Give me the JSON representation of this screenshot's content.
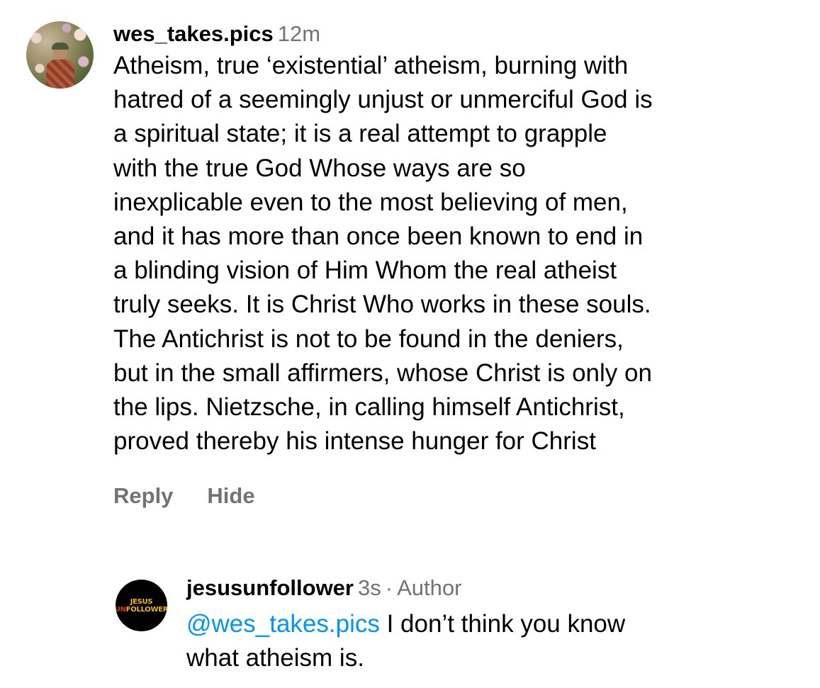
{
  "comment": {
    "username": "wes_takes.pics",
    "timestamp": "12m",
    "text_lines": [
      "Atheism, true ‘existential’ atheism, burning with",
      "hatred of a seemingly unjust or unmerciful God is",
      "a spiritual state; it is a real attempt to grapple",
      "with the true God Whose ways are so",
      "inexplicable even to the most believing of men,",
      "and it has more than once been known to end in",
      "a blinding vision of Him Whom the real atheist",
      "truly seeks. It is Christ Who works in these souls.",
      "The Antichrist is not to be found in the deniers,",
      "but in the small affirmers, whose Christ is only on",
      "the lips. Nietzsche, in calling himself Antichrist,",
      "proved thereby his intense hunger for Christ"
    ],
    "actions": {
      "reply_label": "Reply",
      "hide_label": "Hide"
    }
  },
  "reply": {
    "username": "jesusunfollower",
    "timestamp": "3s",
    "separator": "·",
    "author_label": "Author",
    "mention": "@wes_takes.pics",
    "text_line1": "I don’t think you know",
    "text_line2": "what atheism is.",
    "avatar_logo_top": "JESUS",
    "avatar_logo_un": "UN",
    "avatar_logo_rest": "FOLLOWER"
  },
  "colors": {
    "secondary_text": "#737373",
    "mention_link": "#0095f6",
    "logo_yellow": "#f3b514",
    "logo_red": "#d4341f"
  }
}
